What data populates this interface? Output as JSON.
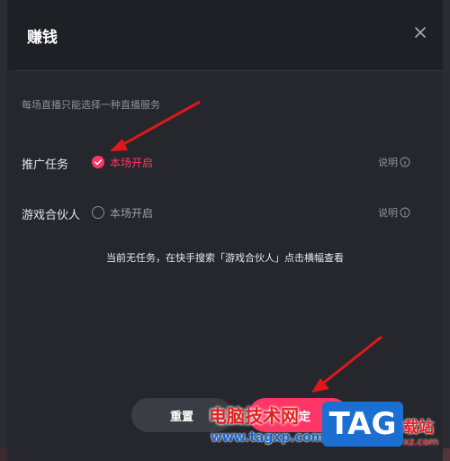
{
  "dialog": {
    "title": "赚钱",
    "hint": "每场直播只能选择一种直播服务",
    "rows": [
      {
        "label": "推广任务",
        "option": "本场开启",
        "checked": true,
        "explain": "说明"
      },
      {
        "label": "游戏合伙人",
        "option": "本场开启",
        "checked": false,
        "explain": "说明"
      }
    ],
    "notice": "当前无任务，在快手搜索「游戏合伙人」点击横幅查看",
    "buttons": {
      "reset": "重置",
      "confirm": "确定"
    }
  },
  "watermark": {
    "site_name": "电脑技术网",
    "url": "www.tagxp.com",
    "logo": "TAG",
    "suffix": "载站",
    "suffix_url": "xz.com"
  },
  "colors": {
    "accent": "#fe3666",
    "background": "#26272d",
    "annotation_arrow": "#e01818"
  },
  "icons": {
    "close": "close-icon",
    "check": "check-icon",
    "info": "info-icon"
  }
}
